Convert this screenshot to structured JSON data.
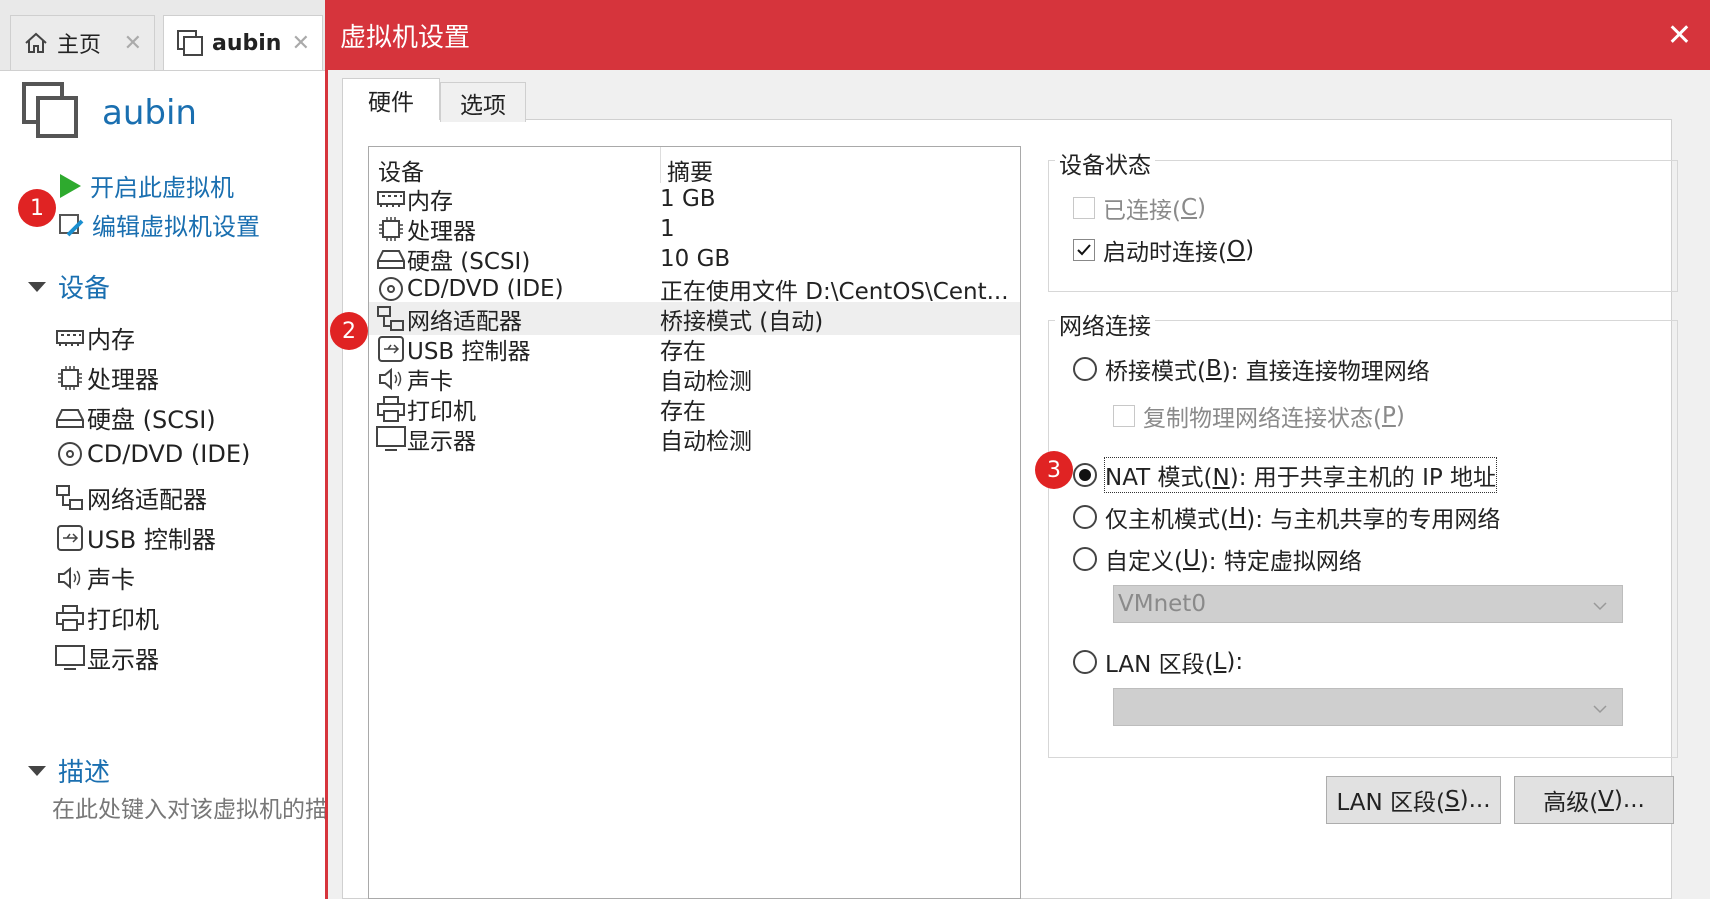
{
  "app": {
    "tabs": [
      {
        "label": "主页",
        "icon": "home-icon"
      },
      {
        "label": "aubin",
        "icon": "vm-icon"
      }
    ],
    "vm_title": "aubin",
    "actions": {
      "power_on": "开启此虚拟机",
      "edit_settings": "编辑虚拟机设置"
    },
    "devices_section": "设备",
    "devices": [
      {
        "label": "内存",
        "icon": "memory-icon"
      },
      {
        "label": "处理器",
        "icon": "cpu-icon"
      },
      {
        "label": "硬盘 (SCSI)",
        "icon": "harddisk-icon"
      },
      {
        "label": "CD/DVD (IDE)",
        "icon": "cd-icon"
      },
      {
        "label": "网络适配器",
        "icon": "network-icon"
      },
      {
        "label": "USB 控制器",
        "icon": "usb-icon"
      },
      {
        "label": "声卡",
        "icon": "sound-icon"
      },
      {
        "label": "打印机",
        "icon": "printer-icon"
      },
      {
        "label": "显示器",
        "icon": "display-icon"
      }
    ],
    "description_section": "描述",
    "description_placeholder": "在此处键入对该虚拟机的描述。"
  },
  "badges": [
    "1",
    "2",
    "3"
  ],
  "dialog": {
    "title": "虚拟机设置",
    "tabs": [
      "硬件",
      "选项"
    ],
    "list_headers": {
      "device": "设备",
      "summary": "摘要"
    },
    "rows": [
      {
        "device": "内存",
        "summary": "1 GB",
        "icon": "memory-icon"
      },
      {
        "device": "处理器",
        "summary": "1",
        "icon": "cpu-icon"
      },
      {
        "device": "硬盘 (SCSI)",
        "summary": "10 GB",
        "icon": "harddisk-icon"
      },
      {
        "device": "CD/DVD (IDE)",
        "summary": "正在使用文件 D:\\CentOS\\Cent...",
        "icon": "cd-icon"
      },
      {
        "device": "网络适配器",
        "summary": "桥接模式 (自动)",
        "icon": "network-icon",
        "selected": true
      },
      {
        "device": "USB 控制器",
        "summary": "存在",
        "icon": "usb-icon"
      },
      {
        "device": "声卡",
        "summary": "自动检测",
        "icon": "sound-icon"
      },
      {
        "device": "打印机",
        "summary": "存在",
        "icon": "printer-icon"
      },
      {
        "device": "显示器",
        "summary": "自动检测",
        "icon": "display-icon"
      }
    ],
    "device_status": {
      "label": "设备状态",
      "connected": {
        "text": "已连接(",
        "key": "C",
        "tail": ")",
        "checked": false,
        "disabled": true
      },
      "connect_on_start": {
        "text": "启动时连接(",
        "key": "O",
        "tail": ")",
        "checked": true
      }
    },
    "network": {
      "label": "网络连接",
      "bridged": {
        "text": "桥接模式(",
        "key": "B",
        "tail": "): 直接连接物理网络",
        "selected": false
      },
      "replicate": {
        "text": "复制物理网络连接状态(",
        "key": "P",
        "tail": ")",
        "checked": false,
        "disabled": true
      },
      "nat": {
        "text": "NAT 模式(",
        "key": "N",
        "tail": "): 用于共享主机的 IP 地址",
        "selected": true
      },
      "host_only": {
        "text": "仅主机模式(",
        "key": "H",
        "tail": "): 与主机共享的专用网络",
        "selected": false
      },
      "custom": {
        "text": "自定义(",
        "key": "U",
        "tail": "): 特定虚拟网络",
        "selected": false
      },
      "custom_value": "VMnet0",
      "lan": {
        "text": "LAN 区段(",
        "key": "L",
        "tail": "):",
        "selected": false
      },
      "lan_value": ""
    },
    "buttons": {
      "lan_segments": {
        "text": "LAN 区段(",
        "key": "S",
        "tail": ")..."
      },
      "advanced": {
        "text": "高级(",
        "key": "V",
        "tail": ")..."
      }
    }
  },
  "colors": {
    "titlebar": "#d6343c",
    "link": "#1a6fb0",
    "badge": "#e02323"
  }
}
